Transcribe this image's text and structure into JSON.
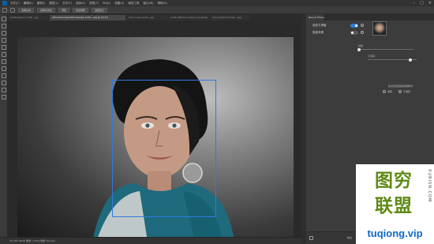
{
  "colors": {
    "accent": "#2f7bdc",
    "app_bg": "#2a2a2a",
    "panel_bg": "#3c3c3c",
    "wm_green": "#5f8a16",
    "wm_blue": "#0f67c8"
  },
  "menubar": {
    "items": [
      "文件(F)",
      "编辑(E)",
      "图像(I)",
      "图层(L)",
      "文字(Y)",
      "选择(S)",
      "滤镜(T)",
      "3D(D)",
      "视图(V)",
      "增效工具",
      "窗口(W)",
      "帮助(H)"
    ],
    "window_controls": [
      "–",
      "□",
      "✕"
    ]
  },
  "optionsbar": {
    "buttons": [
      "选择主体",
      "选择并遮住",
      "调整",
      "自动调整",
      "适配窗口"
    ]
  },
  "tabs": [
    {
      "label": "shutterstock_1146…jpg",
      "active": false
    },
    {
      "label": "attractive-beautiful-beauty-1130…jpg @ 33.3%",
      "active": true
    },
    {
      "label": "face-close-smile…jpg",
      "active": false
    },
    {
      "label": "adult-affection-black-and-white…jpg",
      "active": false
    },
    {
      "label": "top-portrait-woman…jpg",
      "active": false
    }
  ],
  "statusbar": {
    "text": "33.33%   5616 像素 x 3744 像素 (72 ppi)"
  },
  "panel": {
    "title": "Neural Filters",
    "rows": [
      {
        "label": "皮肤平滑度",
        "on": true
      },
      {
        "label": "智能肖像",
        "on": false
      }
    ],
    "slider1_label": "模糊",
    "slider2_label": "平滑度",
    "question": "您对该滤镜感到满意吗？",
    "options": [
      "满意",
      "不满意"
    ],
    "output_label": "输出"
  },
  "watermark": {
    "line1": "图穷",
    "line2": "联盟",
    "vertical": "XURISN.COM",
    "url": "tuqiong.vip"
  }
}
